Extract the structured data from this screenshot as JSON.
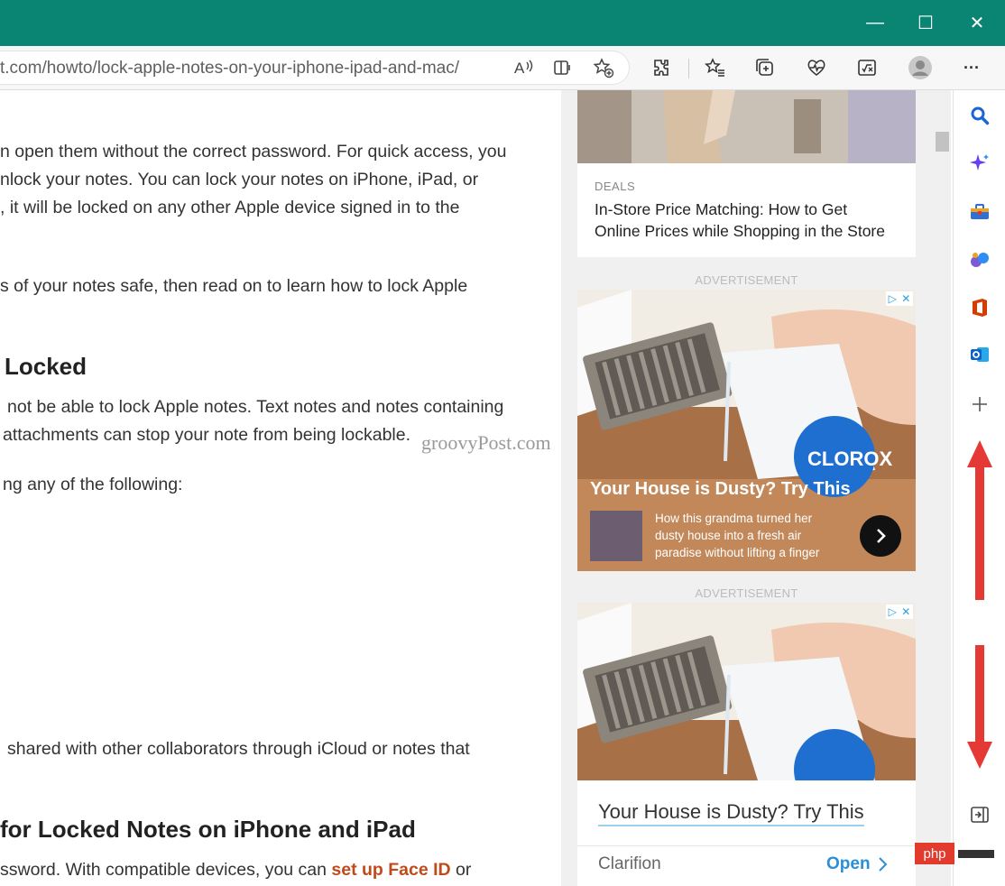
{
  "browser": {
    "url": "t.com/howto/lock-apple-notes-on-your-iphone-ipad-and-mac/",
    "window_buttons": {
      "minimize": "—",
      "maximize": "☐",
      "close": "✕"
    },
    "toolbar_more": "···"
  },
  "article": {
    "lines": [
      "n open them without the correct password. For quick access, you",
      "nlock your notes. You can lock your notes on iPhone, iPad, or",
      ", it will be locked on any other Apple device signed in to the",
      "s of your notes safe, then read on to learn how to lock Apple"
    ],
    "heading1": "Locked",
    "lines2": [
      "not be able to lock Apple notes. Text notes and notes containing",
      "attachments can stop your note from being lockable.",
      "ng any of the following:"
    ],
    "lines3": [
      "shared with other collaborators through iCloud or notes that"
    ],
    "heading2": "for Locked Notes on iPhone and iPad",
    "last_line_before": "ssword. With compatible devices, you can ",
    "last_line_link": "set up Face ID",
    "last_line_after": " or",
    "watermark": "groovyPost.com"
  },
  "ads": {
    "deal_card": {
      "category": "DEALS",
      "title_lines": [
        "In-Store Price Matching: How to Get",
        "Online Prices while Shopping in the Store"
      ]
    },
    "advertisement_label": "ADVERTISEMENT",
    "ad1": {
      "headline": "Your House is Dusty? Try This",
      "body_lines": [
        "How this grandma turned her",
        "dusty house into a fresh air",
        "paradise without lifting a finger"
      ],
      "bottle_brand": "CLOROX"
    },
    "ad2": {
      "headline": "Your House is Dusty? Try This",
      "advertiser": "Clarifion",
      "cta": "Open"
    }
  },
  "badge": {
    "php": "php"
  },
  "sidebar": {
    "items": [
      "search-icon",
      "copilot-icon",
      "tools-icon",
      "games-icon",
      "office-icon",
      "outlook-icon",
      "add-icon",
      "hide-sidebar-icon"
    ]
  },
  "colors": {
    "titlebar": "#0b8573",
    "link": "#c04a1a",
    "arrow": "#e53935",
    "ad_bg": "#c2885a"
  }
}
